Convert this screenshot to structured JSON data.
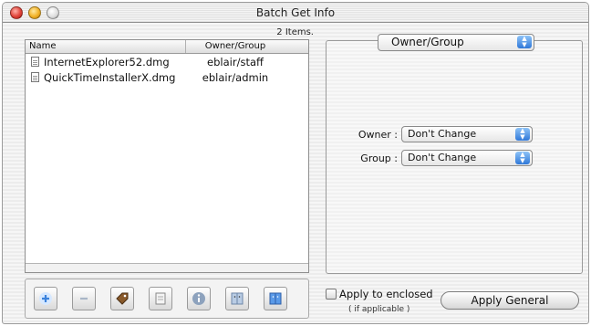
{
  "window": {
    "title": "Batch Get Info"
  },
  "list": {
    "item_count": "2 Items.",
    "columns": [
      "Name",
      "Owner/Group"
    ],
    "rows": [
      {
        "name": "InternetExplorer52.dmg",
        "owner": "eblair/staff"
      },
      {
        "name": "QuickTimeInstallerX.dmg",
        "owner": "eblair/admin"
      }
    ]
  },
  "toolbar": {
    "buttons": [
      "add-icon",
      "remove-icon",
      "label-tag-icon",
      "script-icon",
      "info-icon",
      "finder-icon",
      "finder-selected-icon"
    ]
  },
  "panel": {
    "type_select": "Owner/Group",
    "owner_label": "Owner :",
    "owner_value": "Don't Change",
    "group_label": "Group :",
    "group_value": "Don't Change"
  },
  "apply_enclosed": {
    "label": "Apply to enclosed",
    "sublabel": "( if applicable )",
    "checked": false
  },
  "apply_button": "Apply General",
  "colors": {
    "accent": "#3b82dc",
    "window_bg": "#ececec"
  }
}
